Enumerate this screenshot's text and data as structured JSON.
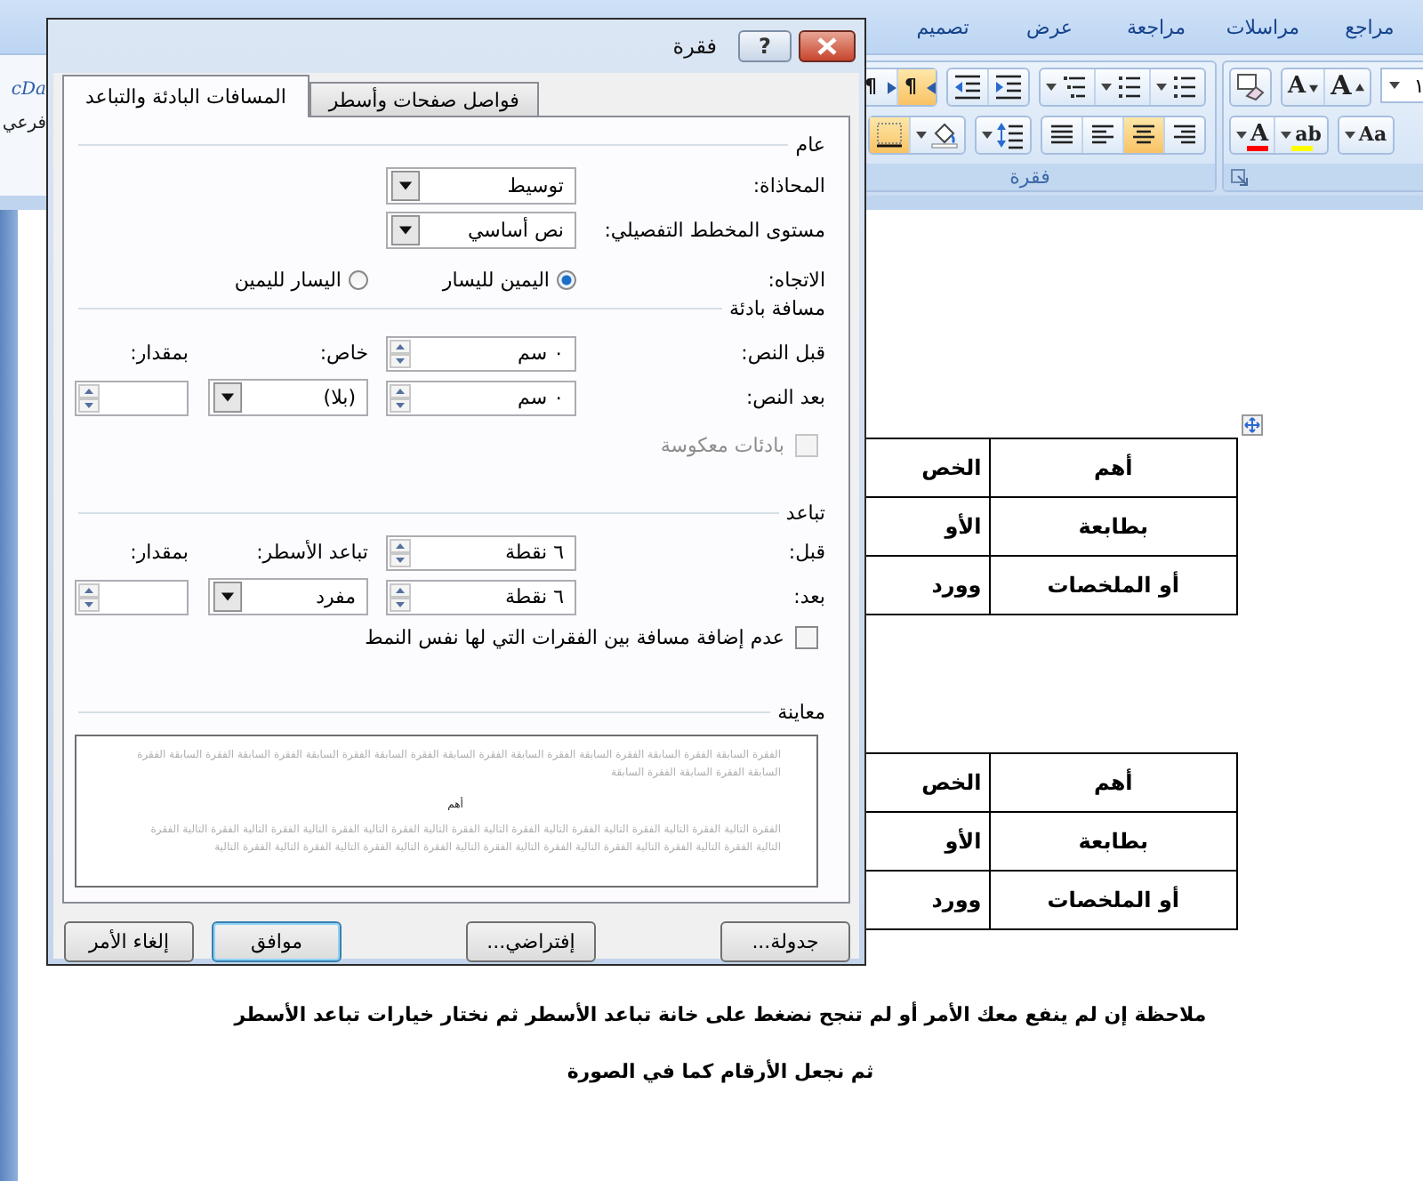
{
  "document_window": {
    "ribbon_tabs": [
      "مراجع",
      "مراسلات",
      "مراجعة",
      "عرض",
      "تصميم"
    ],
    "styles_fragment": {
      "preview": "cDa",
      "style_name": "فرعي"
    },
    "font_group": {
      "size_field": "١",
      "top_row": [
        [
          {
            "kind": "grow",
            "glyph": "A",
            "selected": false
          },
          {
            "kind": "shrink",
            "glyph": "A",
            "selected": false
          }
        ],
        [
          {
            "kind": "clear_format",
            "selected": false
          }
        ]
      ],
      "bottom_row": [
        [
          {
            "kind": "change_case",
            "glyph": "Aa",
            "split": true,
            "selected": false
          }
        ],
        [
          {
            "kind": "highlight",
            "glyph": "ab",
            "color": "#ffff00",
            "split": true,
            "selected": false
          },
          {
            "kind": "font_color",
            "glyph": "A",
            "color": "#ff0000",
            "split": true,
            "selected": false
          }
        ]
      ]
    },
    "paragraph_group": {
      "label": "فقرة",
      "top_row": [
        [
          {
            "kind": "bullets",
            "split": true,
            "selected": false
          },
          {
            "kind": "numbering",
            "split": true,
            "selected": false
          },
          {
            "kind": "multilevel",
            "split": true,
            "selected": false
          }
        ],
        [
          {
            "kind": "indent_inc",
            "selected": false
          },
          {
            "kind": "indent_dec",
            "selected": false
          }
        ],
        [
          {
            "kind": "rtl_para",
            "glyph": "¶",
            "selected": true
          },
          {
            "kind": "ltr_para",
            "glyph": "¶",
            "selected": false
          }
        ]
      ],
      "bottom_row": [
        [
          {
            "kind": "align_right",
            "selected": false
          },
          {
            "kind": "center",
            "selected": true
          },
          {
            "kind": "align_left",
            "selected": false
          },
          {
            "kind": "justify",
            "selected": false
          }
        ],
        [
          {
            "kind": "line_spacing",
            "split": true,
            "selected": false
          }
        ],
        [
          {
            "kind": "shading",
            "split": true,
            "selected": false
          },
          {
            "kind": "border",
            "selected": true
          }
        ]
      ]
    },
    "tables": [
      {
        "rows": [
          [
            "أهم",
            "الخص"
          ],
          [
            "بطابعة",
            "الأو"
          ],
          [
            "أو الملخصات",
            "وورد"
          ]
        ]
      },
      {
        "rows": [
          [
            "أهم",
            "الخص"
          ],
          [
            "بطابعة",
            "الأو"
          ],
          [
            "أو الملخصات",
            "وورد"
          ]
        ]
      }
    ],
    "notes": [
      "ملاحظة إن لم ينفع معك الأمر أو لم تنجح  نضغط على خانة تباعد الأسطر ثم نختار خيارات تباعد الأسطر",
      "ثم نجعل الأرقام كما في الصورة"
    ]
  },
  "dialog": {
    "title": "فقرة",
    "help_button": "?",
    "tabs": [
      {
        "label": "فواصل صفحات وأسطر",
        "selected": false
      },
      {
        "label": "المسافات البادئة والتباعد",
        "selected": true
      }
    ],
    "general": {
      "heading": "عام",
      "alignment": {
        "label": "المحاذاة:",
        "value": "توسيط"
      },
      "outline_level": {
        "label": "مستوى المخطط التفصيلي:",
        "value": "نص أساسي"
      },
      "direction": {
        "label": "الاتجاه:",
        "options": [
          {
            "label": "اليمين لليسار",
            "selected": true
          },
          {
            "label": "اليسار لليمين",
            "selected": false
          }
        ]
      }
    },
    "indentation": {
      "heading": "مسافة بادئة",
      "before_text": {
        "label": "قبل النص:",
        "value": "٠ سم"
      },
      "after_text": {
        "label": "بعد النص:",
        "value": "٠ سم"
      },
      "special": {
        "label": "خاص:",
        "value": "(بلا)"
      },
      "by": {
        "label": "بمقدار:"
      },
      "mirror_indents": {
        "label": "بادئات معكوسة",
        "checked": false,
        "disabled": true
      }
    },
    "spacing": {
      "heading": "تباعد",
      "before": {
        "label": "قبل:",
        "value": "٦ نقطة"
      },
      "after": {
        "label": "بعد:",
        "value": "٦ نقطة"
      },
      "line_spacing": {
        "label": "تباعد الأسطر:",
        "value": "مفرد"
      },
      "at": {
        "label": "بمقدار:"
      },
      "dont_add_space": {
        "label": "عدم إضافة مسافة بين الفقرات التي لها نفس النمط",
        "checked": false,
        "disabled": false
      }
    },
    "preview": {
      "heading": "معاينة",
      "previous_text": "الفقرة السابقة الفقرة السابقة الفقرة السابقة الفقرة السابقة الفقرة السابقة الفقرة السابقة الفقرة السابقة الفقرة السابقة الفقرة السابقة الفقرة السابقة الفقرة السابقة الفقرة السابقة",
      "sample_text": "أهم",
      "following_text": "الفقرة التالية الفقرة التالية الفقرة التالية الفقرة التالية الفقرة التالية الفقرة التالية الفقرة التالية الفقرة التالية الفقرة التالية الفقرة التالية الفقرة التالية الفقرة التالية الفقرة التالية الفقرة التالية الفقرة التالية الفقرة التالية الفقرة التالية الفقرة التالية الفقرة التالية الفقرة التالية"
    },
    "buttons": [
      {
        "label": "جدولة...",
        "kind": "tabs",
        "default": false
      },
      {
        "label": "إفتراضي...",
        "kind": "set_default",
        "default": false
      },
      {
        "label": "موافق",
        "kind": "ok",
        "default": true
      },
      {
        "label": "إلغاء الأمر",
        "kind": "cancel",
        "default": false
      }
    ]
  }
}
